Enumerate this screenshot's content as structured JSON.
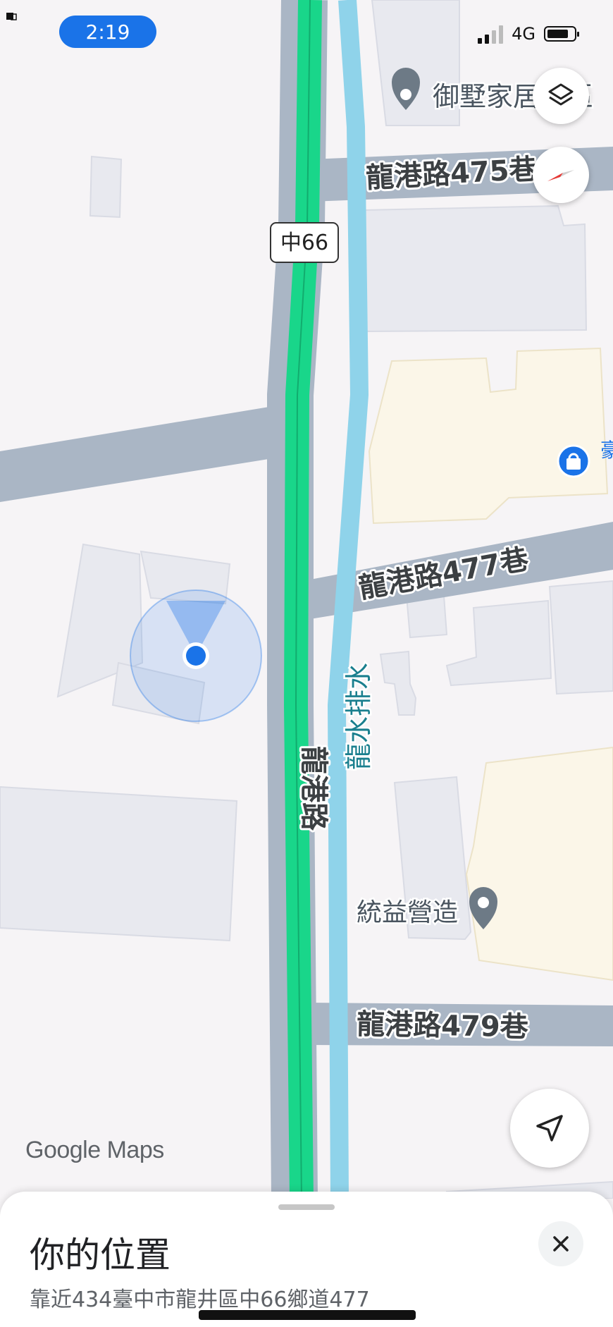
{
  "status_bar": {
    "time": "2:19",
    "network": "4G",
    "battery_level": 0.8
  },
  "map": {
    "road_labels": {
      "main_road": "龍港路",
      "lane_475": "龍港路475巷",
      "lane_477": "龍港路477巷",
      "lane_479": "龍港路479巷",
      "route_shield": "中66",
      "canal": "龍水排水"
    },
    "places": {
      "top_poi": "御墅家居社區",
      "shop_poi": "豪客",
      "company_poi": "統益營造"
    },
    "watermark": "Google Maps"
  },
  "controls": {
    "layers_icon": "layers-icon",
    "compass_icon": "compass-icon",
    "locate_icon": "navigation-arrow-icon"
  },
  "sheet": {
    "title": "你的位置",
    "address": "靠近434臺中市龍井區中66鄉道477",
    "close_icon": "close-icon"
  },
  "colors": {
    "accent": "#1a73e8",
    "route_green": "#19d68a",
    "water": "#8fd3ea",
    "road": "#aab6c5",
    "building": "#e8e9ef",
    "commercial": "#fbf6e8"
  }
}
